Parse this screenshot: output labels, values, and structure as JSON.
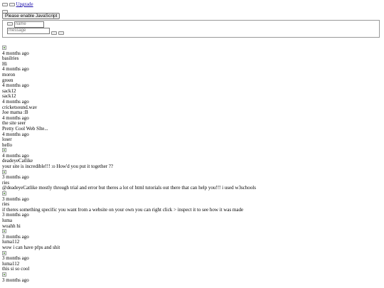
{
  "header": {
    "upgrade_link": "Upgrade"
  },
  "js_notice": "Please enable JavaScript",
  "form": {
    "name_placeholder": "name",
    "message_placeholder": "message"
  },
  "feed": [
    {
      "avatar": true,
      "time": "4 months ago",
      "user": "basilries",
      "text": "Hi"
    },
    {
      "avatar": false,
      "time": "4 months ago",
      "user": "moron",
      "text": "green"
    },
    {
      "avatar": false,
      "time": "4 months ago",
      "user": "sack12",
      "text": "sack12"
    },
    {
      "avatar": false,
      "time": "4 months ago",
      "user": "cricketsound.wav",
      "text": "Joe mama :B"
    },
    {
      "avatar": false,
      "time": "4 months ago",
      "user": "the site seer",
      "text": "Pretty Cool Web SIte..."
    },
    {
      "avatar": false,
      "time": "4 months ago",
      "user": "loser",
      "text": "hello"
    },
    {
      "avatar": true,
      "time": "4 months ago",
      "user": "deadeyeCatlike",
      "text": "your site is incredible!!! :o How'd you put it together ??"
    },
    {
      "avatar": true,
      "time": "3 months ago",
      "user": "ries",
      "text": "@deadeyeCatlike mostly through trial and error but theres a lot of html tutorials out there that can help you!!! i used w3schools"
    },
    {
      "avatar": true,
      "time": "3 months ago",
      "user": "ries",
      "text": "if theres something specific you want from a website on your own you can right click > inspect it to see how it was made"
    },
    {
      "avatar": false,
      "time": "3 months ago",
      "user": "luma",
      "text": "woahh hi"
    },
    {
      "avatar": true,
      "time": "3 months ago",
      "user": "luma112",
      "text": "wow i can have pfps and shit"
    },
    {
      "avatar": true,
      "time": "3 months ago",
      "user": "luma112",
      "text": "this si so cool"
    },
    {
      "avatar": true,
      "time": "3 months ago",
      "user": "",
      "text": ""
    }
  ]
}
